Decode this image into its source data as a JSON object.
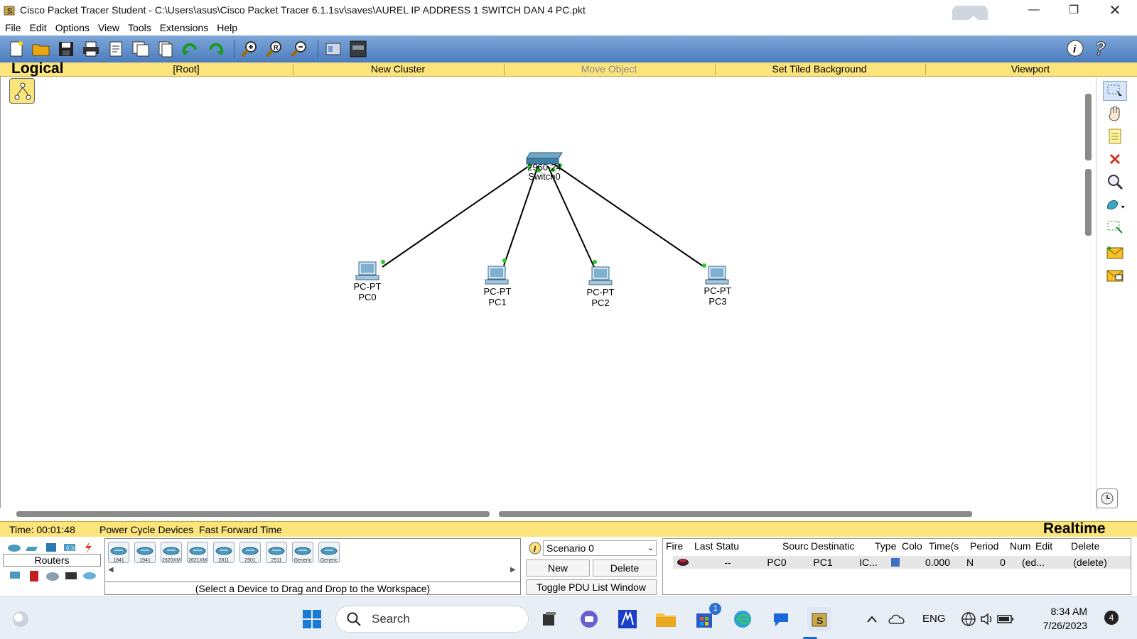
{
  "window": {
    "title": "Cisco Packet Tracer Student - C:\\Users\\asus\\Cisco Packet Tracer 6.1.1sv\\saves\\AUREL IP ADDRESS 1 SWITCH DAN 4 PC.pkt"
  },
  "menu": [
    "File",
    "Edit",
    "Options",
    "View",
    "Tools",
    "Extensions",
    "Help"
  ],
  "workspace_bar": {
    "mode": "Logical",
    "items": [
      "[Root]",
      "New Cluster",
      "Move Object",
      "Set Tiled Background",
      "Viewport"
    ]
  },
  "topology": {
    "switch": {
      "model": "2960-24",
      "name": "Switch0"
    },
    "pcs": [
      {
        "model": "PC-PT",
        "name": "PC0"
      },
      {
        "model": "PC-PT",
        "name": "PC1"
      },
      {
        "model": "PC-PT",
        "name": "PC2"
      },
      {
        "model": "PC-PT",
        "name": "PC3"
      }
    ],
    "link_color": "#000000",
    "port_color": "#22cc22"
  },
  "status": {
    "time_label": "Time: 00:01:48",
    "controls": "Power Cycle Devices  Fast Forward Time",
    "mode": "Realtime"
  },
  "device_panel": {
    "category_label": "Routers",
    "models": [
      "1841",
      "1941",
      "2620XM",
      "2621XM",
      "2811",
      "2901",
      "2911",
      "Generic",
      "Generic"
    ],
    "hint": "(Select a Device to Drag and Drop to the Workspace)"
  },
  "scenario": {
    "selected": "Scenario 0",
    "new_label": "New",
    "delete_label": "Delete",
    "toggle_label": "Toggle PDU List Window"
  },
  "pdu_table": {
    "headers": [
      "Fire",
      "Last Statu",
      "Sourc",
      "Destinatic",
      "Type",
      "Colo",
      "Time(s",
      "Period",
      "Num",
      "Edit",
      "Delete"
    ],
    "rows": [
      {
        "last_status": "--",
        "source": "PC0",
        "destination": "PC1",
        "type": "IC...",
        "color": "#3f6fc0",
        "time": "0.000",
        "periodic": "N",
        "num": "0",
        "edit": "(ed...",
        "delete": "(delete)"
      }
    ]
  },
  "taskbar": {
    "search_placeholder": "Search",
    "lang": "ENG",
    "time": "8:34 AM",
    "date": "7/26/2023",
    "notification_count": "4",
    "store_badge": "1"
  }
}
